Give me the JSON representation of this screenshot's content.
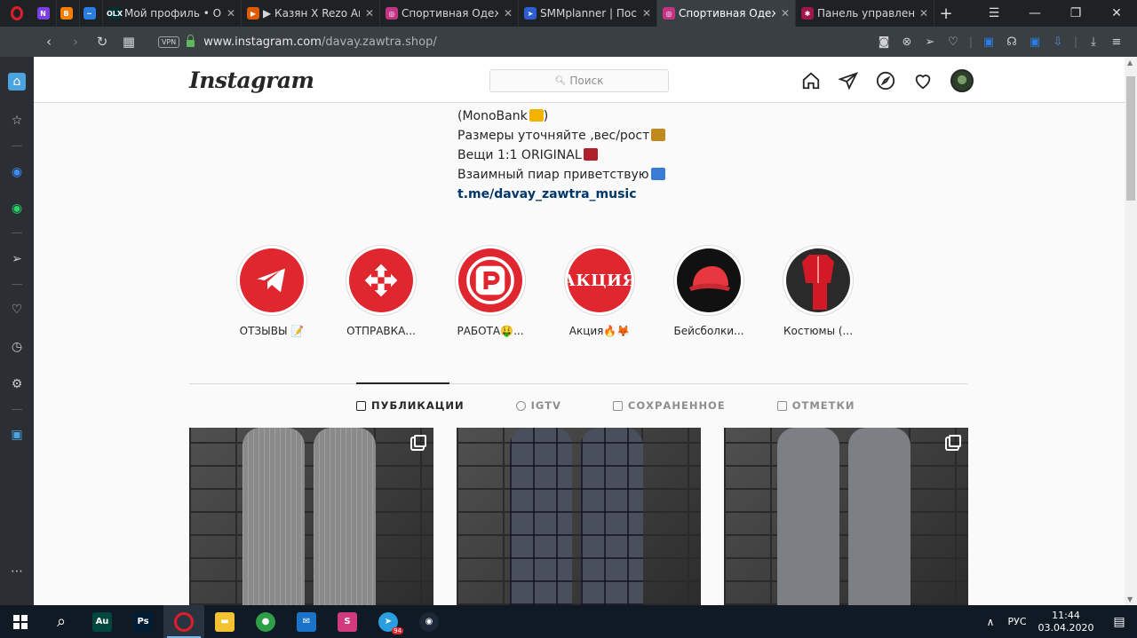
{
  "browser": {
    "tabs": [
      {
        "title": "",
        "favicon_color": "#7b3fe4",
        "favicon_glyph": "N",
        "active": false,
        "small": true
      },
      {
        "title": "",
        "favicon_color": "#f57d00",
        "favicon_glyph": "B",
        "active": false,
        "small": true
      },
      {
        "title": "",
        "favicon_color": "#2a7de1",
        "favicon_glyph": "~",
        "active": false,
        "small": true
      },
      {
        "title": "Мой профиль • OLX",
        "favicon_color": "#002f34",
        "favicon_glyph": "OLX",
        "active": false,
        "small": false
      },
      {
        "title": "▶ Казян X Rezo Ака",
        "favicon_color": "#e05a00",
        "favicon_glyph": "▶",
        "active": false,
        "small": false
      },
      {
        "title": "Спортивная Одежда",
        "favicon_color": "#c13584",
        "favicon_glyph": "◎",
        "active": false,
        "small": false
      },
      {
        "title": "SMMplanner | Посты",
        "favicon_color": "#2d5fd3",
        "favicon_glyph": "➤",
        "active": false,
        "small": false
      },
      {
        "title": "Спортивная Одежда",
        "favicon_color": "#c13584",
        "favicon_glyph": "◎",
        "active": true,
        "small": false
      },
      {
        "title": "Панель управления",
        "favicon_color": "#a0154c",
        "favicon_glyph": "✱",
        "active": false,
        "small": false
      }
    ],
    "url_host": "www.instagram.com",
    "url_path": "/davay.zawtra.shop/",
    "vpn_label": "VPN"
  },
  "instagram": {
    "logo": "Instagram",
    "search_placeholder": "Поиск",
    "bio_lines": [
      {
        "text": "(MonoBank",
        "suffix": ")",
        "emoji_color": "#f0b400"
      },
      {
        "text": "Размеры уточняйте ,вес/рост",
        "suffix": "",
        "emoji_color": "#c08a1e"
      },
      {
        "text": "Вещи 1:1 ORIGINAL",
        "suffix": "",
        "emoji_color": "#b0202a"
      },
      {
        "text": "Взаимный пиар приветствую",
        "suffix": "",
        "emoji_color": "#3a7bd5"
      }
    ],
    "bio_link": "t.me/davay_zawtra_music",
    "highlights": [
      {
        "label": "ОТЗЫВЫ 📝",
        "kind": "telegram",
        "bg": "#e0262e"
      },
      {
        "label": "ОТПРАВКА...",
        "kind": "novaposhta",
        "bg": "#e0262e"
      },
      {
        "label": "РАБОТА🤑...",
        "kind": "rabota",
        "bg": "#e0262e"
      },
      {
        "label": "Акция🔥🦊",
        "kind": "text",
        "bg": "#e0262e",
        "text": "АКЦИЯ"
      },
      {
        "label": "Бейсболки...",
        "kind": "cap",
        "bg": "#111111"
      },
      {
        "label": "Костюмы (...",
        "kind": "suit",
        "bg": "#2a2a2a"
      }
    ],
    "profile_tabs": [
      {
        "label": "ПУБЛИКАЦИИ",
        "active": true
      },
      {
        "label": "IGTV",
        "active": false
      },
      {
        "label": "СОХРАНЕННОЕ",
        "active": false
      },
      {
        "label": "ОТМЕТКИ",
        "active": false
      }
    ],
    "posts": [
      {
        "pants_color": "#8a8a8a",
        "multi": true,
        "pattern": "stripes"
      },
      {
        "pants_color": "#4a4f5c",
        "multi": false,
        "pattern": "check"
      },
      {
        "pants_color": "#7c7f84",
        "multi": true,
        "pattern": "plain"
      }
    ]
  },
  "taskbar": {
    "apps": [
      {
        "name": "search",
        "glyph": "⌕",
        "color": "transparent"
      },
      {
        "name": "audition",
        "glyph": "Au",
        "color": "#00473d"
      },
      {
        "name": "photoshop",
        "glyph": "Ps",
        "color": "#001d34"
      },
      {
        "name": "opera",
        "glyph": "O",
        "color": "#e01e2b",
        "active": true
      },
      {
        "name": "explorer",
        "glyph": "▬",
        "color": "#f2c230"
      },
      {
        "name": "chrome",
        "glyph": "●",
        "color": "#2f9e47"
      },
      {
        "name": "mail",
        "glyph": "✉",
        "color": "#1a73c8"
      },
      {
        "name": "app",
        "glyph": "S",
        "color": "#d13a7c"
      },
      {
        "name": "telegram",
        "glyph": "➤",
        "color": "#2a9ee0",
        "badge": "94"
      },
      {
        "name": "steam",
        "glyph": "◉",
        "color": "#1b2838"
      }
    ],
    "language": "РУС",
    "time": "11:44",
    "date": "03.04.2020"
  }
}
